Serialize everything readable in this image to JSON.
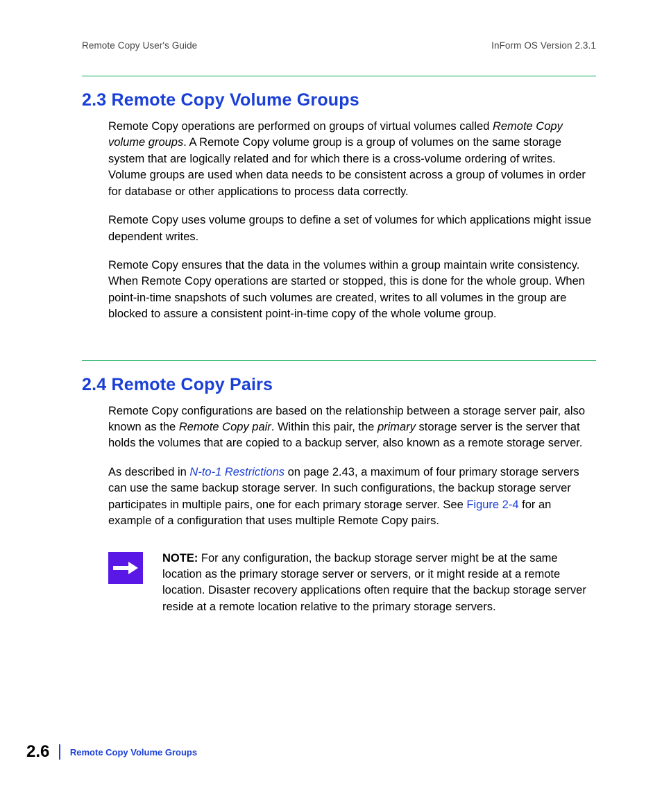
{
  "header": {
    "left": "Remote Copy User's Guide",
    "right": "InForm OS Version 2.3.1"
  },
  "sections": {
    "s23": {
      "heading": "2.3  Remote Copy Volume Groups",
      "p1_a": "Remote Copy operations are performed on groups of virtual volumes called ",
      "p1_em": "Remote Copy volume groups",
      "p1_b": ". A Remote Copy volume group is a group of volumes on the same storage system that are logically related and for which there is a cross-volume ordering of writes. Volume groups are used when data needs to be consistent across a group of volumes in order for database or other applications to process data correctly.",
      "p2": "Remote Copy uses volume groups to define a set of volumes for which applications might issue dependent writes.",
      "p3": "Remote Copy ensures that the data in the volumes within a group maintain write consistency. When Remote Copy operations are started or stopped, this is done for the whole group. When point-in-time snapshots of such volumes are created, writes to all volumes in the group are blocked to assure a consistent point-in-time copy of the whole volume group."
    },
    "s24": {
      "heading": "2.4  Remote Copy Pairs",
      "p1_a": "Remote Copy configurations are based on the relationship between a storage server pair, also known as the ",
      "p1_em1": "Remote Copy pair",
      "p1_b": ". Within this pair, the ",
      "p1_em2": "primary",
      "p1_c": " storage server is the server that holds the volumes that are copied to a backup server, also known as a remote storage server.",
      "p2_a": "As described in ",
      "p2_link1": "N-to-1 Restrictions",
      "p2_b": " on page 2.43, a maximum of four primary storage servers can use the same backup storage server. In such configurations, the backup storage server participates in multiple pairs, one for each primary storage server. See ",
      "p2_link2": "Figure 2-4",
      "p2_c": " for an example of a configuration that uses multiple Remote Copy pairs.",
      "note_label": "NOTE:",
      "note_body": " For any configuration, the backup storage server might be at the same location as the primary storage server or servers, or it might reside at a remote location. Disaster recovery applications often require that the backup storage server reside at a remote location relative to the primary storage servers."
    }
  },
  "footer": {
    "page": "2.6",
    "section": "Remote Copy Volume Groups"
  }
}
